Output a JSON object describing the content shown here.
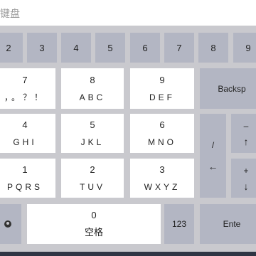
{
  "title": "键盘",
  "number_row": [
    "2",
    "3",
    "4",
    "5",
    "6",
    "7",
    "8",
    "9"
  ],
  "keys": {
    "k7": {
      "num": "7",
      "letters": "，。？！"
    },
    "k8": {
      "num": "8",
      "letters": "ABC"
    },
    "k9": {
      "num": "9",
      "letters": "DEF"
    },
    "k4": {
      "num": "4",
      "letters": "GHI"
    },
    "k5": {
      "num": "5",
      "letters": "JKL"
    },
    "k6": {
      "num": "6",
      "letters": "MNO"
    },
    "k1": {
      "num": "1",
      "letters": "PQRS"
    },
    "k2": {
      "num": "2",
      "letters": "TUV"
    },
    "k3": {
      "num": "3",
      "letters": "WXYZ"
    },
    "k0": {
      "num": "0",
      "letters": "空格"
    }
  },
  "backspace": "Backsp",
  "slash": "/",
  "minus": "–",
  "plus": "+",
  "num_mode": "123",
  "enter": "Ente",
  "icons": {
    "left_arrow": "←",
    "up_arrow": "↑",
    "down_arrow": "↓",
    "globe": "globe-icon"
  },
  "colors": {
    "keyboard_bg": "#c9c9ce",
    "gray_key": "#b3b6c3",
    "white_key": "#ffffff"
  }
}
